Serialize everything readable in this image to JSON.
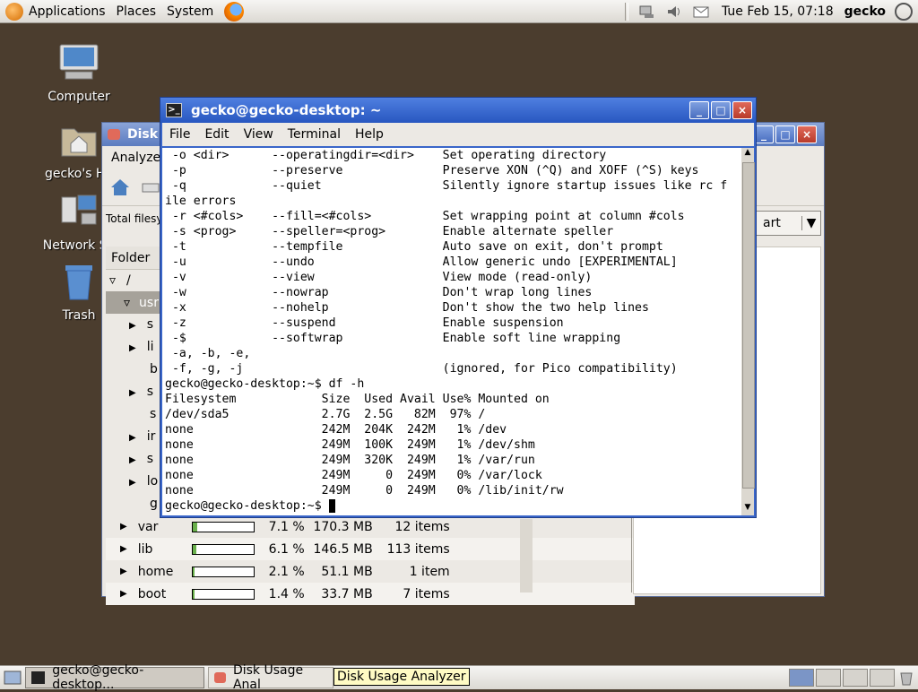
{
  "top_panel": {
    "menus": [
      "Applications",
      "Places",
      "System"
    ],
    "clock": "Tue Feb 15, 07:18",
    "user": "gecko"
  },
  "desktop_icons": [
    "Computer",
    "gecko's Ho",
    "Network Se",
    "Trash"
  ],
  "dua": {
    "title": "Disk",
    "menu_first": "Analyze",
    "total_label": "Total filesy",
    "folder_header": "Folder",
    "root": "/",
    "usr": "usr",
    "chart_btn": "art",
    "sub_letters": [
      "s",
      "li",
      "b",
      "s",
      "s",
      "ir",
      "s",
      "lo",
      "g"
    ],
    "rows": [
      {
        "name": "var",
        "pct": "7.1 %",
        "size": "170.3 MB",
        "items": "12 items",
        "frac": 0.071
      },
      {
        "name": "lib",
        "pct": "6.1 %",
        "size": "146.5 MB",
        "items": "113 items",
        "frac": 0.061
      },
      {
        "name": "home",
        "pct": "2.1 %",
        "size": "51.1 MB",
        "items": "1 item",
        "frac": 0.021
      },
      {
        "name": "boot",
        "pct": "1.4 %",
        "size": "33.7 MB",
        "items": "7 items",
        "frac": 0.014
      }
    ]
  },
  "terminal": {
    "title": "gecko@gecko-desktop: ~",
    "menus": [
      "File",
      "Edit",
      "View",
      "Terminal",
      "Help"
    ],
    "lines": [
      " -o <dir>      --operatingdir=<dir>    Set operating directory",
      " -p            --preserve              Preserve XON (^Q) and XOFF (^S) keys",
      " -q            --quiet                 Silently ignore startup issues like rc f",
      "ile errors",
      " -r <#cols>    --fill=<#cols>          Set wrapping point at column #cols",
      " -s <prog>     --speller=<prog>        Enable alternate speller",
      " -t            --tempfile              Auto save on exit, don't prompt",
      " -u            --undo                  Allow generic undo [EXPERIMENTAL]",
      " -v            --view                  View mode (read-only)",
      " -w            --nowrap                Don't wrap long lines",
      " -x            --nohelp                Don't show the two help lines",
      " -z            --suspend               Enable suspension",
      " -$            --softwrap              Enable soft line wrapping",
      " -a, -b, -e,",
      " -f, -g, -j                            (ignored, for Pico compatibility)",
      "gecko@gecko-desktop:~$ df -h",
      "Filesystem            Size  Used Avail Use% Mounted on",
      "/dev/sda5             2.7G  2.5G   82M  97% /",
      "none                  242M  204K  242M   1% /dev",
      "none                  249M  100K  249M   1% /dev/shm",
      "none                  249M  320K  249M   1% /var/run",
      "none                  249M     0  249M   0% /var/lock",
      "none                  249M     0  249M   0% /lib/init/rw",
      "gecko@gecko-desktop:~$ "
    ]
  },
  "taskbar": {
    "items": [
      "gecko@gecko-desktop...",
      "Disk Usage Anal"
    ],
    "tooltip": "Disk Usage Analyzer"
  }
}
